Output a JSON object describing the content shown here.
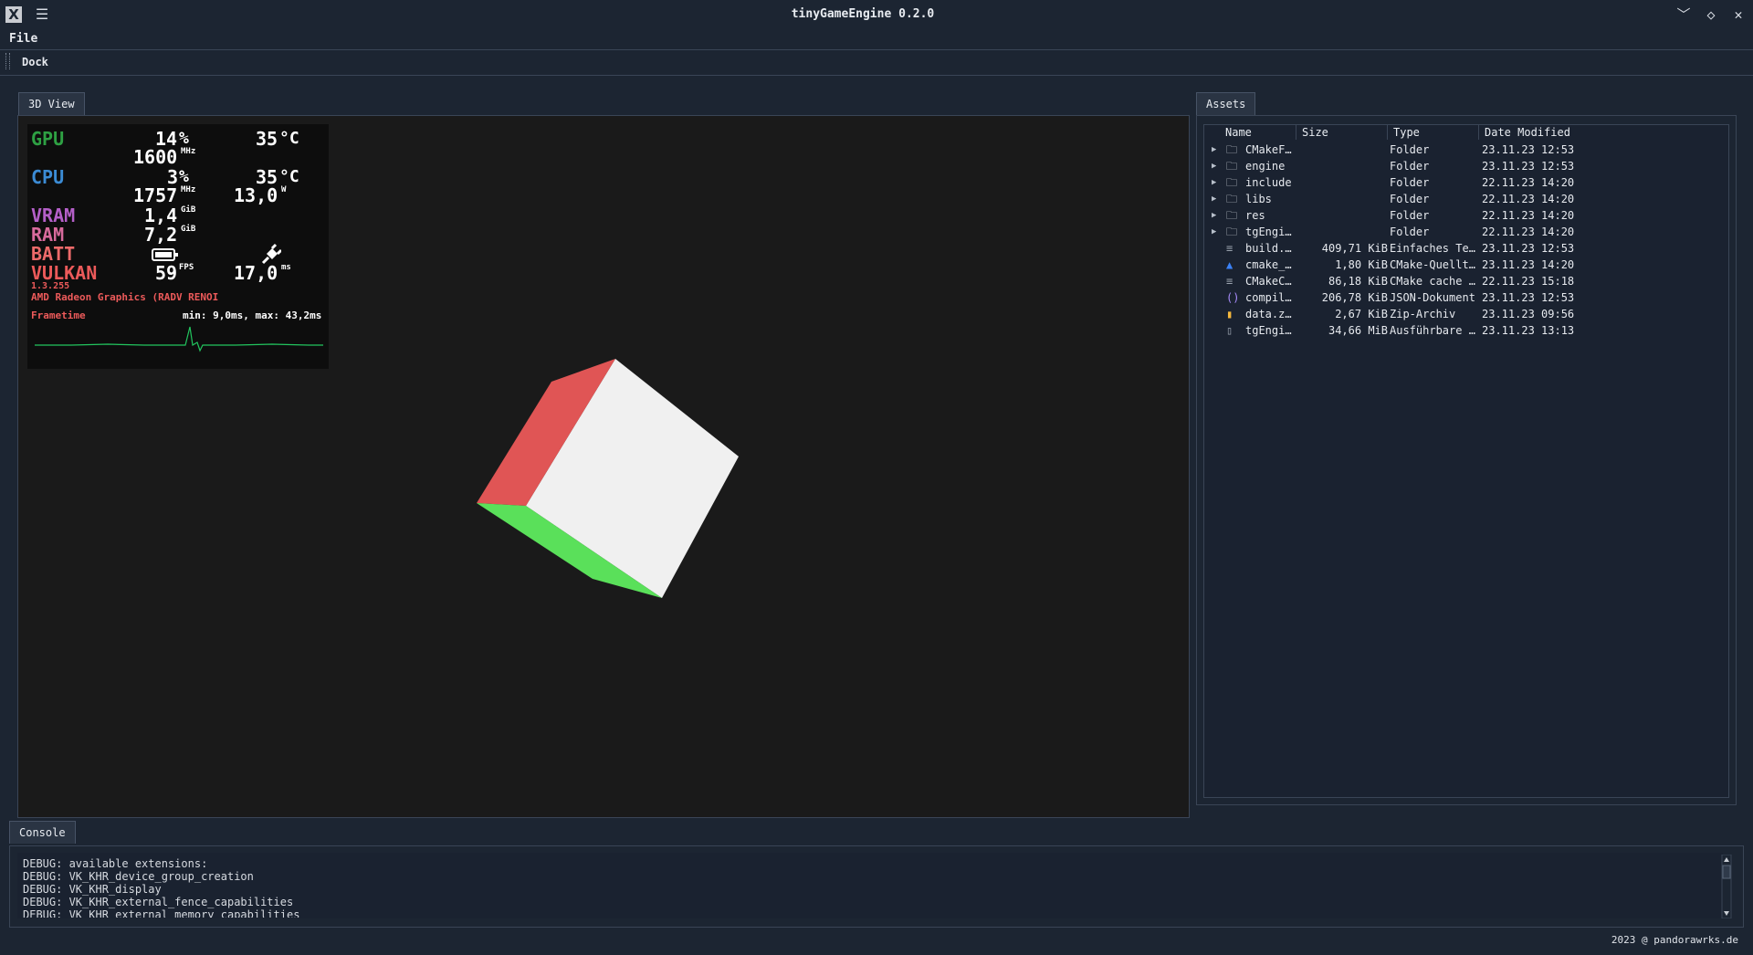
{
  "window": {
    "title": "tinyGameEngine 0.2.0",
    "app_icon": "x-icon",
    "menu_glyph": "☰",
    "controls": {
      "minimize": "﹀",
      "restore": "◇",
      "close": "✕"
    }
  },
  "menubar": {
    "file": "File"
  },
  "dock": {
    "label": "Dock"
  },
  "view": {
    "tab": "3D View",
    "hud": {
      "gpu_label": "GPU",
      "gpu_load": "14",
      "gpu_load_unit": "%",
      "gpu_temp": "35",
      "gpu_temp_unit": "°C",
      "gpu_clock": "1600",
      "gpu_clock_unit": "MHz",
      "cpu_label": "CPU",
      "cpu_load": "3",
      "cpu_load_unit": "%",
      "cpu_temp": "35",
      "cpu_temp_unit": "°C",
      "cpu_clock": "1757",
      "cpu_clock_unit": "MHz",
      "cpu_power": "13,0",
      "cpu_power_unit": "W",
      "vram_label": "VRAM",
      "vram_value": "1,4",
      "vram_unit": "GiB",
      "ram_label": "RAM",
      "ram_value": "7,2",
      "ram_unit": "GiB",
      "batt_label": "BATT",
      "vulkan_label": "VULKAN",
      "fps": "59",
      "fps_unit": "FPS",
      "frametime": "17,0",
      "frametime_unit": "ms",
      "vulkan_version": "1.3.255",
      "device": "AMD Radeon Graphics (RADV RENOI",
      "frametime_label": "Frametime",
      "frametime_range": "min: 9,0ms, max: 43,2ms"
    },
    "colors": {
      "gpu": "#2ea043",
      "cpu": "#3b8bd4",
      "vram": "#b45fc8",
      "ram": "#d86a9c",
      "batt": "#ec6a6a",
      "vulkan": "#ec5a5a",
      "graph": "#22c55e"
    }
  },
  "assets": {
    "tab": "Assets",
    "columns": [
      "Name",
      "Size",
      "Type",
      "Date Modified"
    ],
    "rows": [
      {
        "name": "CMakeF…",
        "size": "",
        "type": "Folder",
        "date": "23.11.23 12:53",
        "icon": "folder-icon",
        "expandable": true
      },
      {
        "name": "engine",
        "size": "",
        "type": "Folder",
        "date": "23.11.23 12:53",
        "icon": "folder-icon",
        "expandable": true
      },
      {
        "name": "include",
        "size": "",
        "type": "Folder",
        "date": "22.11.23 14:20",
        "icon": "folder-icon",
        "expandable": true
      },
      {
        "name": "libs",
        "size": "",
        "type": "Folder",
        "date": "22.11.23 14:20",
        "icon": "folder-icon",
        "expandable": true
      },
      {
        "name": "res",
        "size": "",
        "type": "Folder",
        "date": "22.11.23 14:20",
        "icon": "folder-icon",
        "expandable": true
      },
      {
        "name": "tgEngi…",
        "size": "",
        "type": "Folder",
        "date": "22.11.23 14:20",
        "icon": "folder-icon",
        "expandable": true
      },
      {
        "name": "build.…",
        "size": "409,71 KiB",
        "type": "Einfaches Te…",
        "date": "23.11.23 12:53",
        "icon": "text-file-icon",
        "expandable": false
      },
      {
        "name": "cmake_…",
        "size": "1,80 KiB",
        "type": "CMake-Quellt…",
        "date": "23.11.23 14:20",
        "icon": "cmake-file-icon",
        "expandable": false
      },
      {
        "name": "CMakeC…",
        "size": "86,18 KiB",
        "type": "CMake cache …",
        "date": "22.11.23 15:18",
        "icon": "text-file-icon",
        "expandable": false
      },
      {
        "name": "compil…",
        "size": "206,78 KiB",
        "type": "JSON-Dokument",
        "date": "23.11.23 12:53",
        "icon": "json-file-icon",
        "expandable": false
      },
      {
        "name": "data.z…",
        "size": "2,67 KiB",
        "type": "Zip-Archiv",
        "date": "23.11.23 09:56",
        "icon": "zip-file-icon",
        "expandable": false
      },
      {
        "name": "tgEngi…",
        "size": "34,66 MiB",
        "type": "Ausführbare …",
        "date": "23.11.23 13:13",
        "icon": "executable-file-icon",
        "expandable": false
      }
    ]
  },
  "console": {
    "tab": "Console",
    "lines": [
      "DEBUG: available extensions:",
      "DEBUG: VK_KHR_device_group_creation",
      "DEBUG: VK_KHR_display",
      "DEBUG: VK_KHR_external_fence_capabilities",
      "DEBUG: VK_KHR_external_memory_capabilities"
    ]
  },
  "footer": "2023 @ pandorawrks.de",
  "cube_colors": {
    "top": "#f0f0f0",
    "left": "#e05555",
    "bottom": "#5ae05a"
  }
}
